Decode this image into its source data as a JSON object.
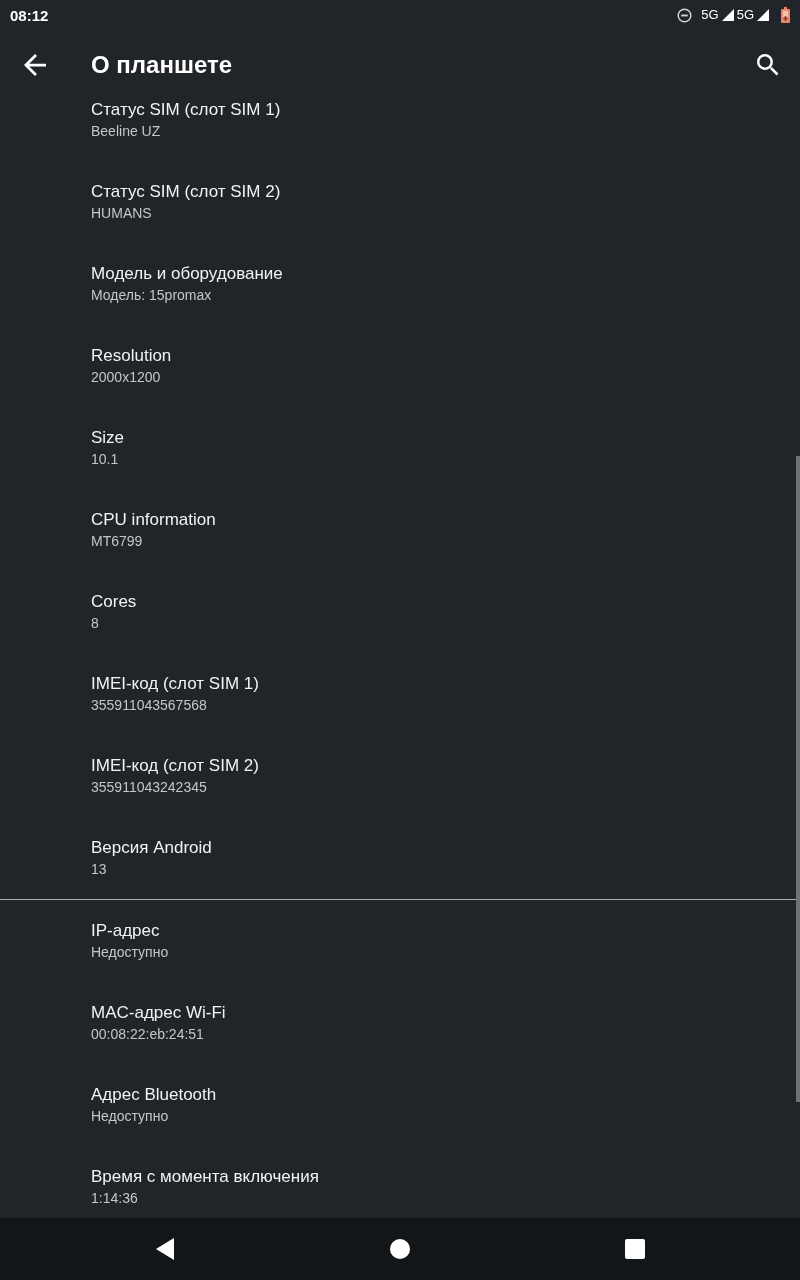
{
  "status_bar": {
    "time": "08:12",
    "networks": [
      "5G",
      "5G"
    ]
  },
  "toolbar": {
    "title": "О планшете"
  },
  "groups": [
    {
      "items": [
        {
          "title": "Статус SIM (слот SIM 1)",
          "summary": "Beeline UZ"
        },
        {
          "title": "Статус SIM (слот SIM 2)",
          "summary": "HUMANS"
        },
        {
          "title": "Модель и оборудование",
          "summary": "Модель: 15promax"
        },
        {
          "title": "Resolution",
          "summary": "2000x1200"
        },
        {
          "title": "Size",
          "summary": "10.1"
        },
        {
          "title": "CPU information",
          "summary": "MT6799"
        },
        {
          "title": "Cores",
          "summary": "8"
        },
        {
          "title": "IMEI-код (слот SIM 1)",
          "summary": "355911043567568"
        },
        {
          "title": "IMEI-код (слот SIM 2)",
          "summary": "355911043242345"
        },
        {
          "title": "Версия Android",
          "summary": "13"
        }
      ]
    },
    {
      "items": [
        {
          "title": "IP-адрес",
          "summary": "Недоступно"
        },
        {
          "title": "MAC-адрес Wi-Fi",
          "summary": "00:08:22:eb:24:51"
        },
        {
          "title": "Адрес Bluetooth",
          "summary": "Недоступно"
        },
        {
          "title": "Время с момента включения",
          "summary": "1:14:36"
        }
      ]
    }
  ]
}
